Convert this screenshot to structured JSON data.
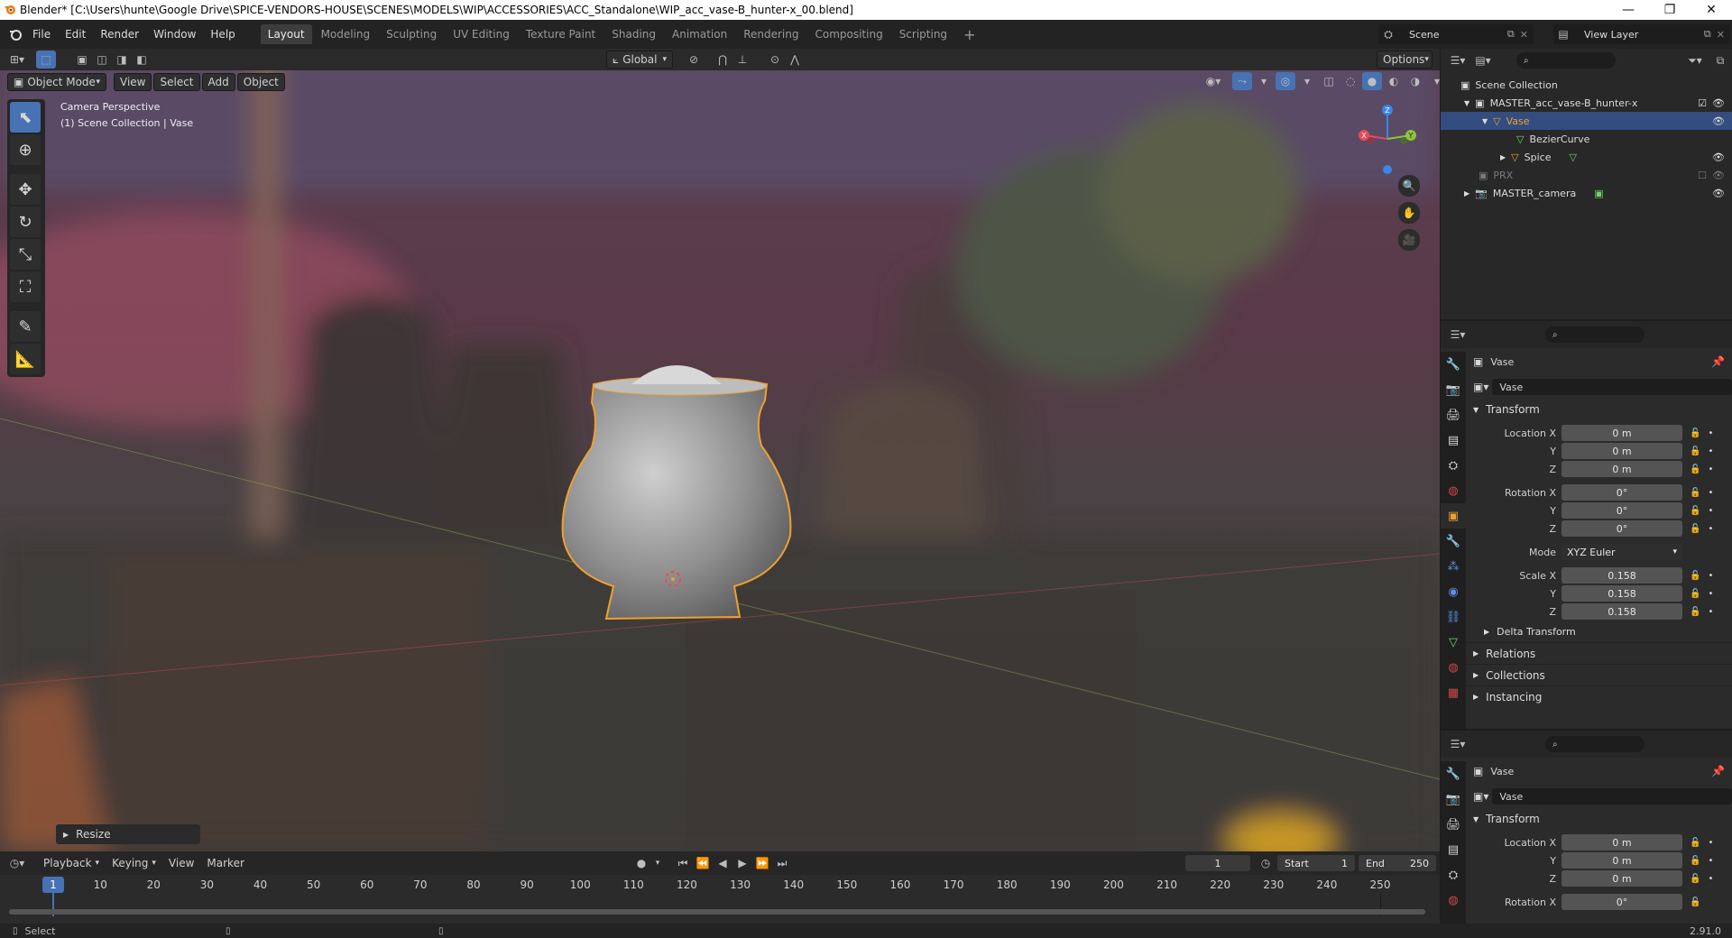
{
  "title_bar": {
    "title": "Blender* [C:\\Users\\hunte\\Google Drive\\SPICE-VENDORS-HOUSE\\SCENES\\MODELS\\WIP\\ACCESSORIES\\ACC_Standalone\\WIP_acc_vase-B_hunter-x_00.blend]",
    "icon": "blender-logo-icon",
    "minimize": "—",
    "maximize": "❐",
    "close": "✕"
  },
  "menu": [
    "File",
    "Edit",
    "Render",
    "Window",
    "Help"
  ],
  "workspaces": [
    "Layout",
    "Modeling",
    "Sculpting",
    "UV Editing",
    "Texture Paint",
    "Shading",
    "Animation",
    "Rendering",
    "Compositing",
    "Scripting"
  ],
  "active_workspace": "Layout",
  "add_workspace": "+",
  "scene": {
    "label": "Scene"
  },
  "view_layer": {
    "label": "View Layer"
  },
  "viewport": {
    "orientation": "Global",
    "options": "Options",
    "mode": "Object Mode",
    "menus": [
      "View",
      "Select",
      "Add",
      "Object"
    ],
    "overlay_line1": "Camera Perspective",
    "overlay_line2": "(1) Scene Collection | Vase",
    "gizmo_axes": [
      "X",
      "Y",
      "Z"
    ],
    "resize_panel": "Resize"
  },
  "outliner": {
    "search_placeholder": "",
    "rows": [
      {
        "label": "Scene Collection",
        "indent": 0
      },
      {
        "label": "MASTER_acc_vase-B_hunter-x",
        "indent": 1
      },
      {
        "label": "Vase",
        "indent": 2
      },
      {
        "label": "BezierCurve",
        "indent": 3
      },
      {
        "label": "Spice",
        "indent": 3
      },
      {
        "label": "PRX",
        "indent": 1
      },
      {
        "label": "MASTER_camera",
        "indent": 1
      }
    ]
  },
  "properties_top": {
    "object_name": "Vase",
    "name_field": "Vase",
    "transform_header": "Transform",
    "location": {
      "label": "Location X",
      "x": "0 m",
      "y": "0 m",
      "z": "0 m"
    },
    "rotation": {
      "label": "Rotation X",
      "x": "0°",
      "y": "0°",
      "z": "0°"
    },
    "mode": {
      "label": "Mode",
      "value": "XYZ Euler"
    },
    "scale": {
      "label": "Scale X",
      "x": "0.158",
      "y": "0.158",
      "z": "0.158"
    },
    "axis_y": "Y",
    "axis_z": "Z",
    "delta": "Delta Transform",
    "relations": "Relations",
    "collections": "Collections",
    "instancing": "Instancing"
  },
  "properties_bottom": {
    "object_name": "Vase",
    "name_field": "Vase",
    "transform_header": "Transform",
    "location": {
      "label": "Location X",
      "x": "0 m",
      "y": "0 m",
      "z": "0 m"
    },
    "rotation_label": "Rotation X",
    "rotation_x": "0°",
    "axis_y": "Y",
    "axis_z": "Z"
  },
  "timeline": {
    "menus": [
      "Playback",
      "Keying",
      "View",
      "Marker"
    ],
    "current_frame": "1",
    "start_label": "Start",
    "start": "1",
    "end_label": "End",
    "end": "250",
    "frame_marker": "1",
    "ticks": [
      "10",
      "20",
      "30",
      "40",
      "50",
      "60",
      "70",
      "80",
      "90",
      "100",
      "110",
      "120",
      "130",
      "140",
      "150",
      "160",
      "170",
      "180",
      "190",
      "200",
      "210",
      "220",
      "230",
      "240",
      "250"
    ]
  },
  "status_bar": {
    "left": "Select",
    "version": "2.91.0"
  },
  "colors": {
    "accent": "#4772b3",
    "selection_outline": "#f0a030",
    "x_axis": "#e84a5a",
    "y_axis": "#8cc43c",
    "z_axis": "#3a86e8"
  }
}
